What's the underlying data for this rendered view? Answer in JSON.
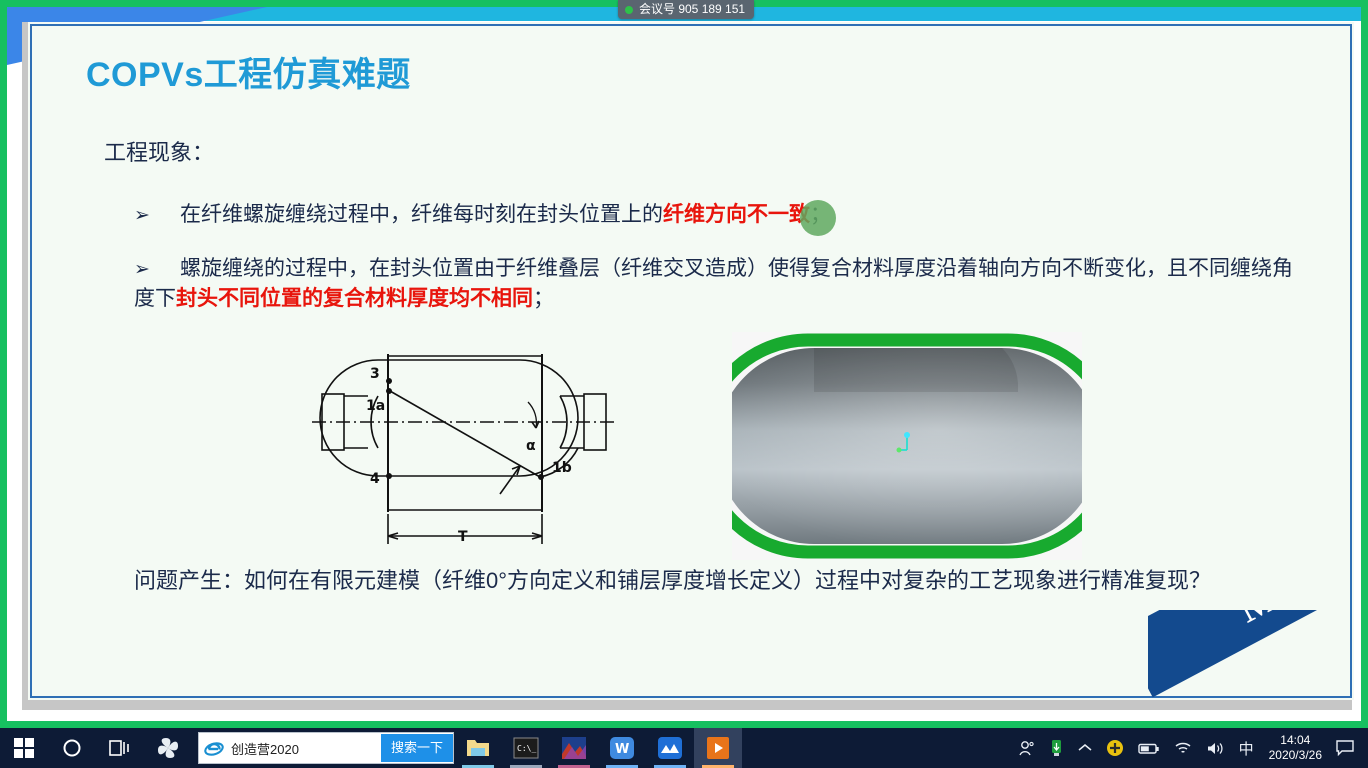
{
  "meeting": {
    "label": "会议号 905 189 151",
    "status_color": "#2ec24a"
  },
  "slide": {
    "title": "COPVs工程仿真难题",
    "title_color": "#1f9ad6",
    "lead": "工程现象：",
    "bullet_marker": "➢",
    "bullets": [
      {
        "pre": "在纤维螺旋缠绕过程中，纤维每时刻在封头位置上的",
        "highlight": "纤维方向不一致",
        "post": "；"
      },
      {
        "pre": "螺旋缠绕的过程中，在封头位置由于纤维叠层（纤维交叉造成）使得复合材料厚度沿着轴向方向不断变化，且不同缠绕角度下",
        "highlight": "封头不同位置的复合材料厚度均不相同",
        "post": "；"
      }
    ],
    "question": "问题产生：如何在有限元建模（纤维0°方向定义和铺层厚度增长定义）过程中对复杂的工艺现象进行精准复现？",
    "figure_line_labels": {
      "l3": "3",
      "l1a": "1a",
      "l4": "4",
      "alpha": "α",
      "l1b": "1b",
      "t": "T"
    },
    "watermark": "MVT"
  },
  "taskbar": {
    "start": "start-button",
    "cortana": "cortana-search",
    "taskview": "task-view",
    "search_box": {
      "text": "创造营2020",
      "go_label": "搜索一下"
    },
    "apps": [
      {
        "name": "file-explorer",
        "glyph": "📁"
      },
      {
        "name": "command-prompt",
        "glyph": "C:\\"
      },
      {
        "name": "photo-viewer",
        "glyph": "▰"
      },
      {
        "name": "wps-office",
        "glyph": "W"
      },
      {
        "name": "mountain-app",
        "glyph": "⛰"
      },
      {
        "name": "presentation-app",
        "glyph": "▶"
      }
    ],
    "tray": {
      "people": "⚇",
      "usb": "⇩",
      "chevron": "︿",
      "security": "✛",
      "battery": "▭",
      "wifi": "◞",
      "volume": "🔊",
      "ime": "中",
      "time": "14:04",
      "date": "2020/3/26",
      "notification": "▭"
    }
  }
}
